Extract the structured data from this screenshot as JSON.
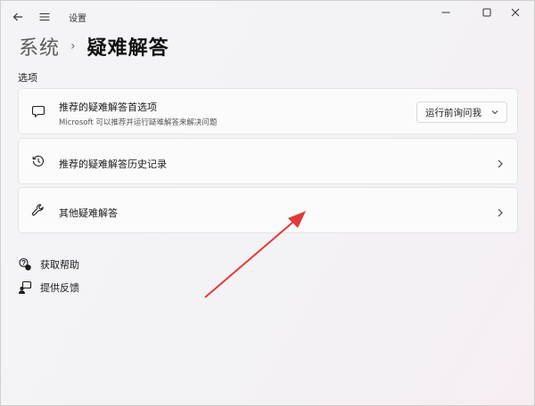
{
  "window": {
    "title": "设置",
    "icons": {
      "back": "back-arrow-icon",
      "menu": "hamburger-icon",
      "minimize": "minimize-icon",
      "maximize": "maximize-icon",
      "close": "close-icon"
    }
  },
  "breadcrumb": {
    "parent": "系统",
    "separator": "›",
    "current": "疑难解答"
  },
  "section": {
    "label": "选项"
  },
  "cards": [
    {
      "title": "推荐的疑难解答首选项",
      "subtitle": "Microsoft 可以推荐并运行疑难解答来解决问题",
      "icon": "chat-bubble-icon",
      "dropdown_value": "运行前询问我"
    },
    {
      "title": "推荐的疑难解答历史记录",
      "icon": "history-icon"
    },
    {
      "title": "其他疑难解答",
      "icon": "wrench-icon"
    }
  ],
  "links": {
    "help": "获取帮助",
    "feedback": "提供反馈"
  },
  "colors": {
    "annotation_arrow": "#e03a3a",
    "card_bg": "#fbfbfb"
  }
}
